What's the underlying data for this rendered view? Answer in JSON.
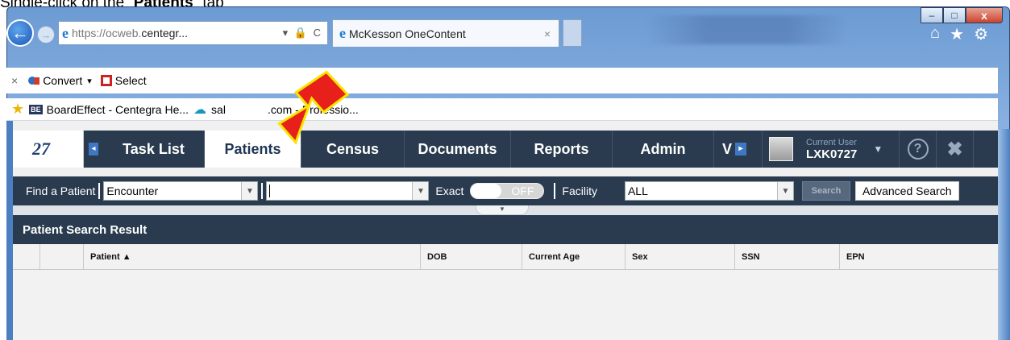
{
  "instruction": {
    "prefix": "Single-click on the “",
    "bold": "Patients",
    "suffix": "” tab"
  },
  "browser": {
    "address_host_dim": "https://ocweb.",
    "address_host": "centegr...",
    "address_tail": "▾ 🔒 C",
    "tab_title": "McKesson OneContent",
    "tab_close": "×",
    "controls": {
      "minimize": "–",
      "maximize": "□",
      "close": "x"
    },
    "tools": {
      "home": "⌂",
      "favorites": "★",
      "settings": "⚙"
    }
  },
  "command_bar": {
    "close": "×",
    "convert": "Convert",
    "convert_caret": "▾",
    "select": "Select"
  },
  "favorites_bar": {
    "item1_badge": "BE",
    "item1": "BoardEffect - Centegra He...",
    "item2_prefix": "sal",
    "item2": ".com - Professio..."
  },
  "app_nav": {
    "logo_text": "27",
    "left_arrow": "◂",
    "items": [
      "Task List",
      "Patients",
      "Census",
      "Documents",
      "Reports",
      "Admin",
      "V"
    ],
    "more_arrow": "▸",
    "user_label": "Current User",
    "user_id": "LXK0727",
    "user_caret": "▼",
    "help_icon": "?",
    "close_icon": "✖"
  },
  "search": {
    "find_label": "Find a Patient",
    "type_value": "Encounter",
    "query_value": "",
    "exact_label": "Exact",
    "toggle_label": "OFF",
    "facility_label": "Facility",
    "facility_value": "ALL",
    "search_button": "Search",
    "advanced_button": "Advanced Search",
    "dropdown_arrow": "▼"
  },
  "results": {
    "title": "Patient Search Result",
    "columns": [
      "Patient ▲",
      "DOB",
      "Current Age",
      "Sex",
      "SSN",
      "EPN"
    ],
    "pull_handle": "▼"
  }
}
